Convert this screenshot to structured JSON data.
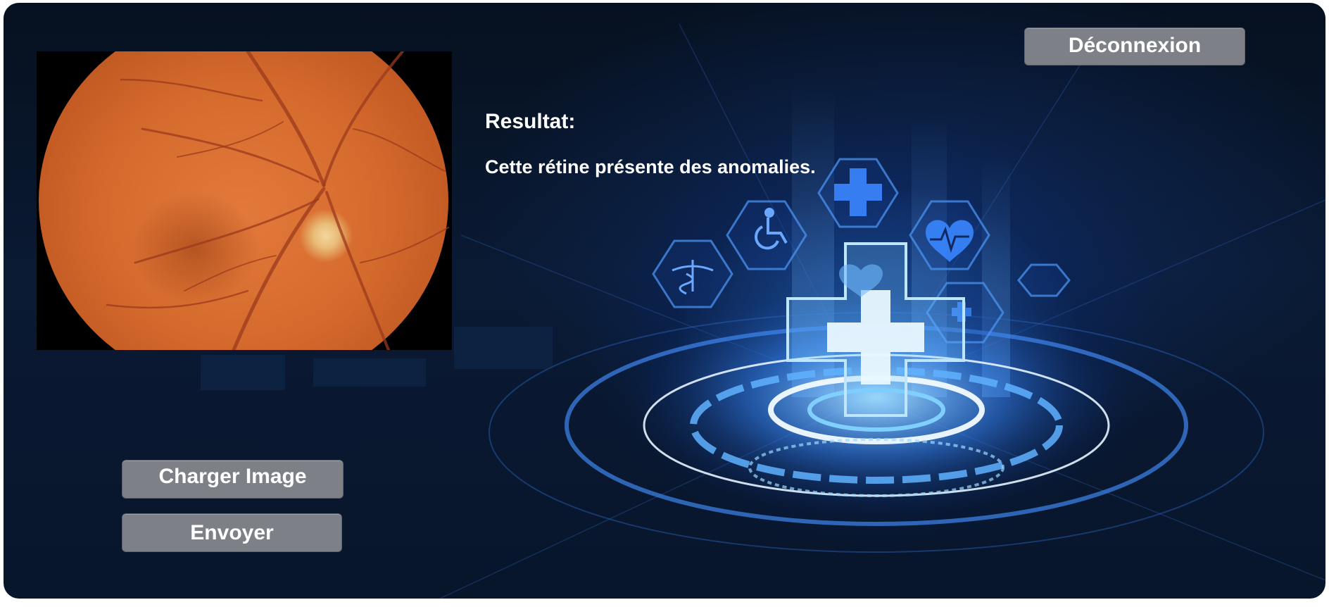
{
  "header": {
    "logout_label": "Déconnexion"
  },
  "result": {
    "title": "Resultat:",
    "message": "Cette rétine présente des anomalies."
  },
  "actions": {
    "load_label": "Charger Image",
    "send_label": "Envoyer"
  },
  "icons": [
    "medical-cross-icon",
    "wheelchair-icon",
    "heart-pulse-icon",
    "caduceus-icon",
    "cross-shield-icon"
  ],
  "colors": {
    "button_bg": "#7d8086",
    "background": "#0a1a33",
    "accent_glow": "#2f8cff"
  }
}
